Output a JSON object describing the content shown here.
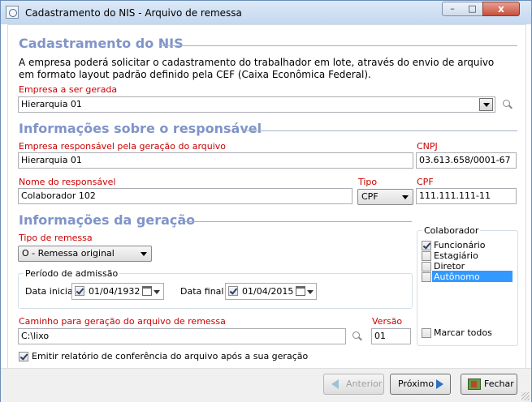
{
  "window": {
    "title": "Cadastramento do NIS - Arquivo de remessa",
    "close_glyph": "x",
    "min_glyph": "–",
    "max_glyph": "□"
  },
  "header": {
    "title": "Cadastramento do NIS",
    "description": "A empresa poderá solicitar o cadastramento do trabalhador em lote, através do envio de arquivo em formato layout padrão definido pela CEF (Caixa Econômica Federal)."
  },
  "empresa": {
    "label": "Empresa a ser gerada",
    "value": "Hierarquia 01"
  },
  "responsavel": {
    "title": "Informações sobre o responsável",
    "empresa_label": "Empresa responsável pela geração do arquivo",
    "empresa_value": "Hierarquia 01",
    "cnpj_label": "CNPJ",
    "cnpj_value": "03.613.658/0001-67",
    "nome_label": "Nome do responsável",
    "nome_value": "Colaborador 102",
    "tipo_label": "Tipo",
    "tipo_value": "CPF",
    "cpf_label": "CPF",
    "cpf_value": "111.111.111-11"
  },
  "geracao": {
    "title": "Informações da geração",
    "tipo_remessa_label": "Tipo de remessa",
    "tipo_remessa_value": "O - Remessa original",
    "periodo_title": "Período de admissão",
    "data_inicial_label": "Data inicial",
    "data_inicial_value": "01/04/1932",
    "data_final_label": "Data final",
    "data_final_value": "01/04/2015",
    "caminho_label": "Caminho para geração do arquivo de remessa",
    "caminho_value": "C:\\lixo",
    "versao_label": "Versão",
    "versao_value": "01",
    "emitir_label": "Emitir relatório de conferência do arquivo após a sua geração"
  },
  "colaborador": {
    "title": "Colaborador",
    "items": [
      {
        "label": "Funcionário",
        "checked": true
      },
      {
        "label": "Estagiário",
        "checked": false
      },
      {
        "label": "Diretor",
        "checked": false
      },
      {
        "label": "Autônomo",
        "checked": false
      }
    ],
    "marcar_todos": "Marcar todos"
  },
  "footer": {
    "anterior": "Anterior",
    "proximo": "Próximo",
    "fechar": "Fechar"
  },
  "colors": {
    "section_title": "#7f94c9",
    "required_label": "#cc0000",
    "selection": "#3399ff"
  }
}
